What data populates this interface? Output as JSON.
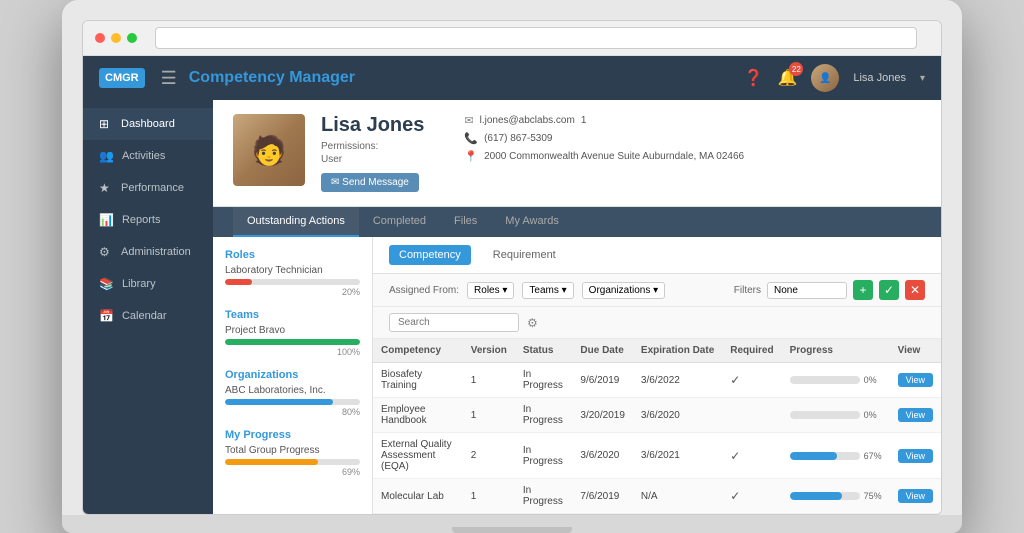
{
  "browser": {
    "dots": [
      "red",
      "yellow",
      "green"
    ]
  },
  "topnav": {
    "logo": "CMGR",
    "title": "Competency Manager",
    "user": "Lisa Jones",
    "badge_count": "22"
  },
  "sidebar": {
    "items": [
      {
        "label": "Dashboard",
        "icon": "⊞"
      },
      {
        "label": "Activities",
        "icon": "👥"
      },
      {
        "label": "Performance",
        "icon": "★"
      },
      {
        "label": "Reports",
        "icon": "📊"
      },
      {
        "label": "Administration",
        "icon": "⚙"
      },
      {
        "label": "Library",
        "icon": "📚"
      },
      {
        "label": "Calendar",
        "icon": "📅"
      }
    ]
  },
  "profile": {
    "name": "Lisa Jones",
    "permissions_label": "Permissions:",
    "role": "User",
    "send_message": "✉ Send Message",
    "email": "l.jones@abclabs.com",
    "email_number": "1",
    "phone": "(617) 867-5309",
    "address": "2000 Commonwealth Avenue Suite Auburndale, MA 02466"
  },
  "tabs": [
    {
      "label": "Outstanding Actions",
      "active": true
    },
    {
      "label": "Completed"
    },
    {
      "label": "Files"
    },
    {
      "label": "My Awards"
    }
  ],
  "subtabs": [
    {
      "label": "Competency",
      "active": true
    },
    {
      "label": "Requirement"
    }
  ],
  "left_panel": {
    "roles_title": "Roles",
    "roles_items": [
      {
        "name": "Laboratory Technician",
        "progress": 20,
        "color": "#e74c3c"
      }
    ],
    "teams_title": "Teams",
    "teams_items": [
      {
        "name": "Project Bravo",
        "progress": 100,
        "color": "#27ae60"
      }
    ],
    "organizations_title": "Organizations",
    "organizations_items": [
      {
        "name": "ABC Laboratories, Inc.",
        "progress": 80,
        "color": "#3498db"
      }
    ],
    "my_progress_title": "My Progress",
    "my_progress_items": [
      {
        "name": "Total Group Progress",
        "progress": 69,
        "color": "#f39c12"
      }
    ]
  },
  "filter": {
    "assigned_from_label": "Assigned From:",
    "filter_label": "Filters",
    "dropdowns": [
      "Roles ▾",
      "Teams ▾",
      "Organizations ▾"
    ],
    "filter_value": "None",
    "search_placeholder": "Search"
  },
  "table": {
    "headers": [
      "Competency",
      "Version",
      "Status",
      "Due Date",
      "Expiration Date",
      "Required",
      "Progress",
      "View"
    ],
    "rows": [
      {
        "competency": "Biosafety Training",
        "version": "1",
        "status": "In Progress",
        "due_date": "9/6/2019",
        "exp_date": "3/6/2022",
        "required": true,
        "progress": 0,
        "view": "View"
      },
      {
        "competency": "Employee Handbook",
        "version": "1",
        "status": "In Progress",
        "due_date": "3/20/2019",
        "exp_date": "3/6/2020",
        "required": false,
        "progress": 0,
        "view": "View"
      },
      {
        "competency": "External Quality Assessment (EQA)",
        "version": "2",
        "status": "In Progress",
        "due_date": "3/6/2020",
        "exp_date": "3/6/2021",
        "required": true,
        "progress": 67,
        "view": "View"
      },
      {
        "competency": "Molecular Lab",
        "version": "1",
        "status": "In Progress",
        "due_date": "7/6/2019",
        "exp_date": "N/A",
        "required": true,
        "progress": 75,
        "view": "View"
      }
    ]
  }
}
